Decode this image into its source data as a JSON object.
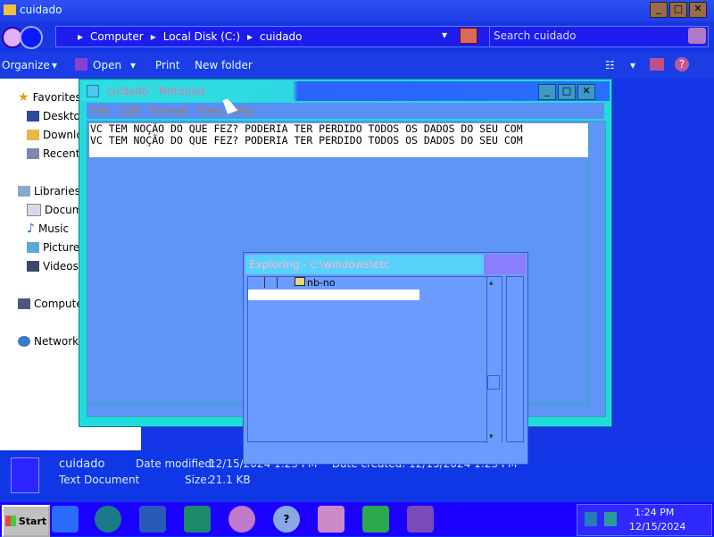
{
  "explorer": {
    "title": "cuidado",
    "address": {
      "crumbs": [
        "Computer",
        "Local Disk (C:)",
        "cuidado"
      ]
    },
    "search": {
      "placeholder": "Search cuidado"
    },
    "toolbar": {
      "organize": "Organize",
      "open": "Open",
      "print": "Print",
      "new_folder": "New folder"
    },
    "nav": {
      "favorites": "Favorites",
      "desktop": "Deskto",
      "downloads": "Downlo",
      "recent": "Recent",
      "libraries": "Libraries",
      "documents": "Docum",
      "music": "Music",
      "pictures": "Picture",
      "videos": "Videos",
      "computer": "Compute",
      "network": "Network"
    },
    "details": {
      "name": "cuidado",
      "type": "Text Document",
      "date_modified_label": "Date modified:",
      "date_modified": "12/15/2024 1:23 PM",
      "date_created": "Date created: 12/15/2024 1:23 PM",
      "size_label": "Size:",
      "size": "21.1 KB"
    }
  },
  "notepad": {
    "title": "cuidado - Notepad",
    "menu": {
      "file": "File",
      "edit": "Edit",
      "format": "Format",
      "view": "View",
      "help": "Help"
    },
    "lines": [
      "VC TEM NOÇÃO DO QUE FEZ? PODERIA TER PERDIDO TODOS OS DADOS DO SEU COM",
      "VC TEM NOÇÃO DO QUE FEZ? PODERIA TER PERDIDO TODOS OS DADOS DO SEU COM"
    ]
  },
  "exploring": {
    "title": "Exploring - c:\\windows\\etc",
    "item": "nb-no"
  },
  "taskbar": {
    "start": "Start",
    "clock_time": "1:24 PM",
    "clock_date": "12/15/2024"
  }
}
